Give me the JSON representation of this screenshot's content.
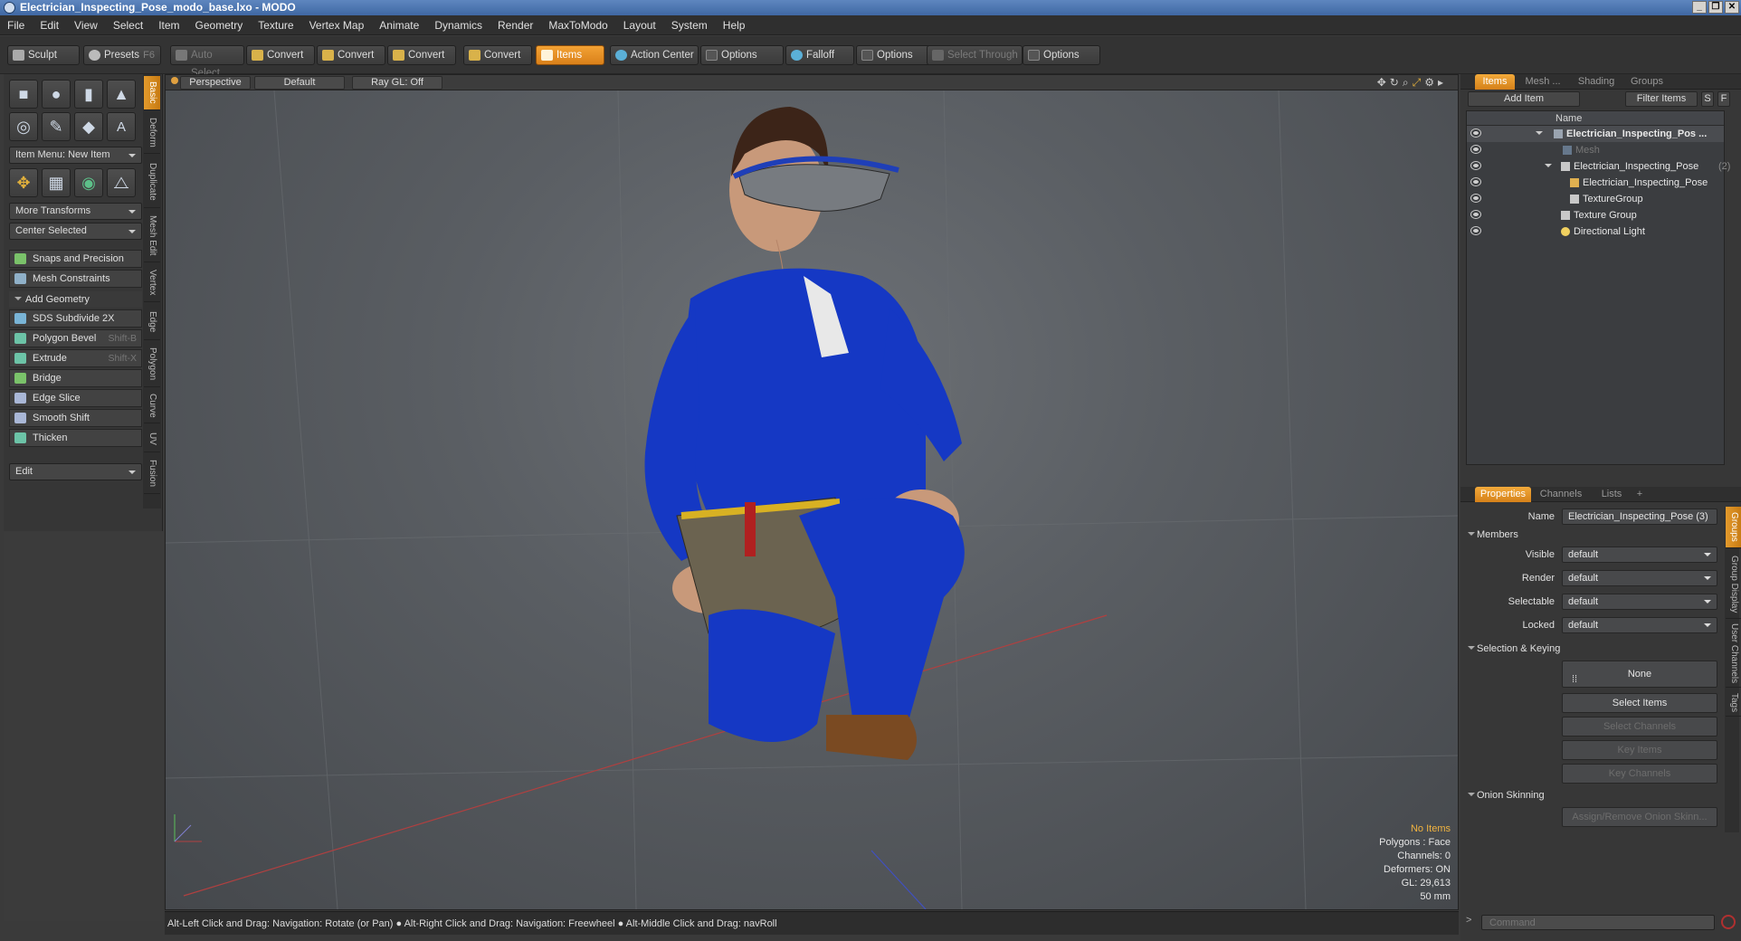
{
  "window": {
    "title": "Electrician_Inspecting_Pose_modo_base.lxo - MODO",
    "controls": [
      "_",
      "❐",
      "✕"
    ]
  },
  "menu": [
    "File",
    "Edit",
    "View",
    "Select",
    "Item",
    "Geometry",
    "Texture",
    "Vertex Map",
    "Animate",
    "Dynamics",
    "Render",
    "MaxToModo",
    "Layout",
    "System",
    "Help"
  ],
  "toolbar": {
    "sculpt": "Sculpt",
    "presets": "Presets",
    "presets_key": "F6",
    "auto_select": "Auto Select",
    "convert1": "Convert",
    "convert2": "Convert",
    "convert3": "Convert",
    "convert4": "Convert",
    "items": "Items",
    "action_center": "Action Center",
    "options1": "Options",
    "falloff": "Falloff",
    "options2": "Options",
    "select_through": "Select Through",
    "options3": "Options"
  },
  "left": {
    "item_menu": "Item Menu: New Item",
    "more_transforms": "More Transforms",
    "center_selected": "Center Selected",
    "snaps": "Snaps and Precision",
    "mesh_constraints": "Mesh Constraints",
    "add_geometry": "Add Geometry",
    "tools": [
      {
        "label": "SDS Subdivide 2X",
        "key": ""
      },
      {
        "label": "Polygon Bevel",
        "key": "Shift-B"
      },
      {
        "label": "Extrude",
        "key": "Shift-X"
      },
      {
        "label": "Bridge",
        "key": ""
      },
      {
        "label": "Edge Slice",
        "key": ""
      },
      {
        "label": "Smooth Shift",
        "key": ""
      },
      {
        "label": "Thicken",
        "key": ""
      }
    ],
    "edit_dropdown": "Edit",
    "vtabs": [
      "Basic",
      "Deform",
      "Duplicate",
      "Mesh Edit",
      "Vertex",
      "Edge",
      "Polygon",
      "Curve",
      "UV",
      "Fusion"
    ]
  },
  "viewport": {
    "view_mode": "Perspective",
    "shading": "Default",
    "raygl": "Ray GL: Off",
    "stats": {
      "selection": "No Items",
      "polygons": "Polygons : Face",
      "channels": "Channels: 0",
      "deformers": "Deformers: ON",
      "gl": "GL: 29,613",
      "scale": "50 mm"
    }
  },
  "status": "Alt-Left Click and Drag: Navigation: Rotate (or Pan) ● Alt-Right Click and Drag: Navigation: Freewheel ● Alt-Middle Click and Drag: navRoll",
  "items_panel": {
    "tabs": [
      "Items",
      "Mesh ...",
      "Shading",
      "Groups"
    ],
    "add_item": "Add Item",
    "filter_items": "Filter Items",
    "s": "S",
    "f": "F",
    "name_header": "Name",
    "rows": [
      {
        "label": "Electrician_Inspecting_Pos ...",
        "suffix": ""
      },
      {
        "label": "Mesh",
        "suffix": ""
      },
      {
        "label": "Electrician_Inspecting_Pose",
        "suffix": "(2)"
      },
      {
        "label": "Electrician_Inspecting_Pose",
        "suffix": ""
      },
      {
        "label": "TextureGroup",
        "suffix": ""
      },
      {
        "label": "Texture Group",
        "suffix": ""
      },
      {
        "label": "Directional Light",
        "suffix": ""
      }
    ]
  },
  "properties_panel": {
    "tabs": [
      "Properties",
      "Channels",
      "Lists",
      "+"
    ],
    "name_label": "Name",
    "name_value": "Electrician_Inspecting_Pose (3)",
    "members": "Members",
    "visible_label": "Visible",
    "visible": "default",
    "render_label": "Render",
    "render": "default",
    "selectable_label": "Selectable",
    "selectable": "default",
    "locked_label": "Locked",
    "locked": "default",
    "selection_keying": "Selection & Keying",
    "none": "None",
    "select_items": "Select Items",
    "select_channels": "Select Channels",
    "key_items": "Key Items",
    "key_channels": "Key Channels",
    "onion": "Onion Skinning",
    "assign_onion": "Assign/Remove Onion Skinn...",
    "side_tabs": [
      "Groups",
      "Group Display",
      "User Channels",
      "Tags"
    ],
    "command_placeholder": "Command"
  }
}
